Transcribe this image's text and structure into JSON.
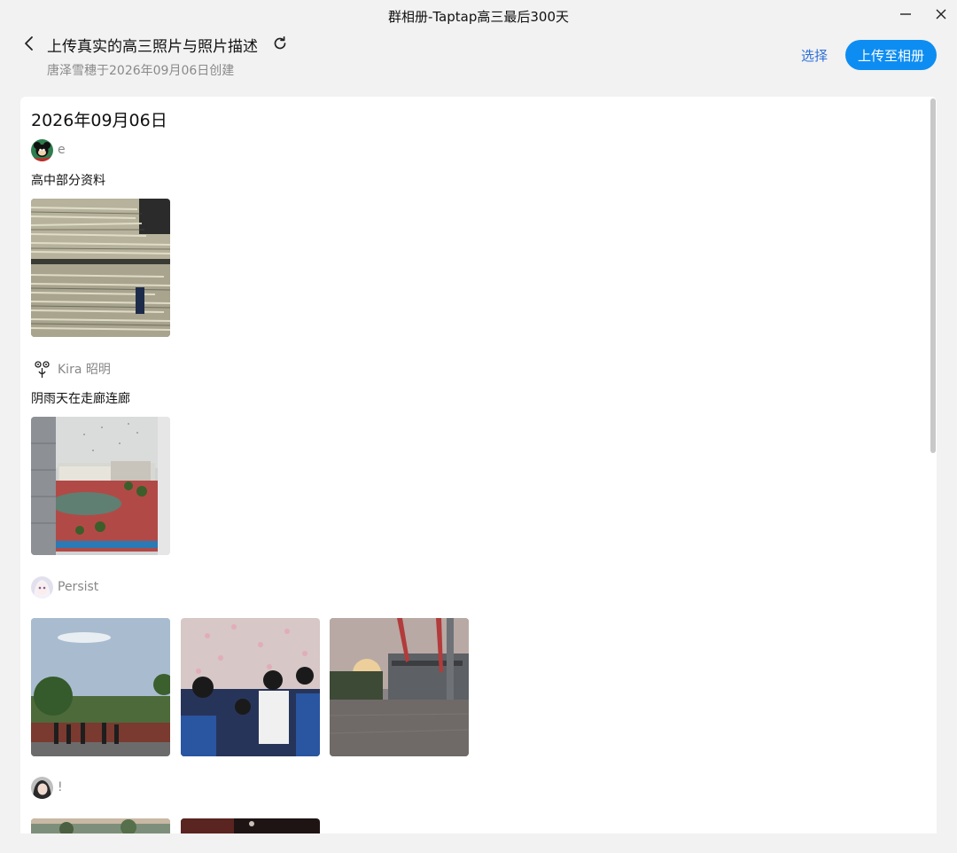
{
  "window": {
    "title": "群相册-Taptap高三最后300天"
  },
  "header": {
    "album_title": "上传真实的高三照片与照片描述",
    "album_subtitle": "唐泽雪穗于2026年09月06日创建",
    "select_label": "选择",
    "upload_label": "上传至相册"
  },
  "feed": {
    "date": "2026年09月06日",
    "posts": [
      {
        "user": "e",
        "description": "高中部分资料",
        "photo_count": 1
      },
      {
        "user": "Kira 昭明",
        "description": "阴雨天在走廊连廊",
        "photo_count": 1
      },
      {
        "user": "Persist",
        "description": "",
        "photo_count": 3
      },
      {
        "user": "!",
        "description": "",
        "photo_count": 2
      }
    ]
  },
  "icons": {
    "back": "chevron-left-icon",
    "refresh": "refresh-icon",
    "minimize": "minimize-icon",
    "close": "close-icon"
  },
  "colors": {
    "accent": "#0d8df2",
    "link": "#2f6fd6",
    "background": "#f2f2f2"
  }
}
